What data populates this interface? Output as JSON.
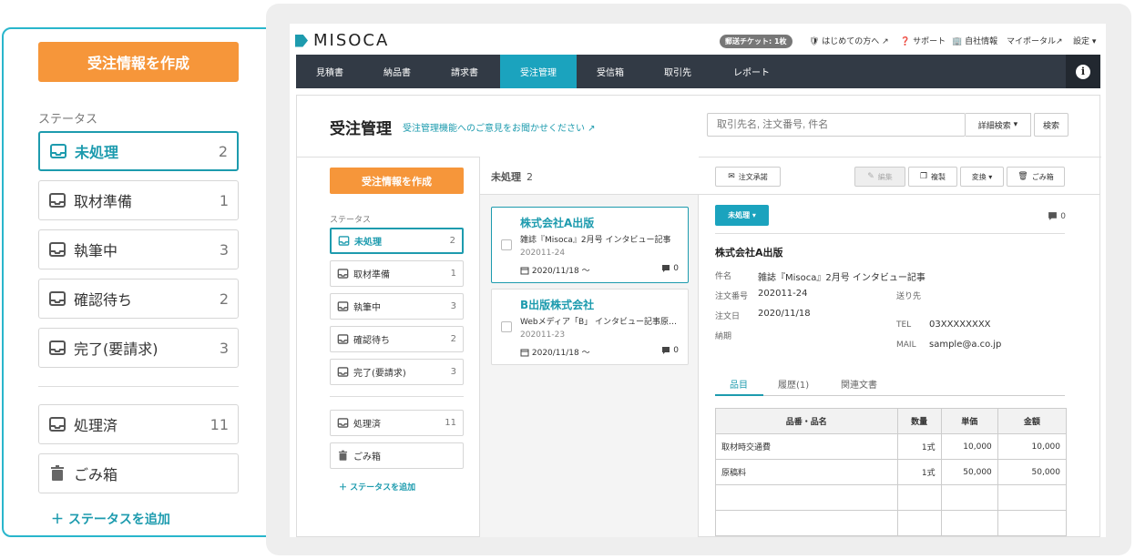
{
  "zoom": {
    "create_button": "受注情報を作成",
    "status_label": "ステータス",
    "items": [
      {
        "label": "未処理",
        "count": "2"
      },
      {
        "label": "取材準備",
        "count": "1"
      },
      {
        "label": "執筆中",
        "count": "3"
      },
      {
        "label": "確認待ち",
        "count": "2"
      },
      {
        "label": "完了(要請求)",
        "count": "3"
      }
    ],
    "processed": {
      "label": "処理済",
      "count": "11"
    },
    "trash": {
      "label": "ごみ箱"
    },
    "add_status": "＋ ステータスを追加"
  },
  "topbar": {
    "logo": "MISOCA",
    "ticket": "郵送チケット: 1枚",
    "links": [
      "はじめての方へ",
      "サポート",
      "自社情報",
      "マイポータル",
      "設定"
    ]
  },
  "nav": {
    "tabs": [
      "見積書",
      "納品書",
      "請求書",
      "受注管理",
      "受信箱",
      "取引先",
      "レポート"
    ],
    "active_index": 3
  },
  "page": {
    "title": "受注管理",
    "feedback_link": "受注管理機能へのご意見をお聞かせください",
    "search_placeholder": "取引先名, 注文番号, 件名",
    "advanced_search": "詳細検索",
    "search_button": "検索"
  },
  "sidebar": {
    "create_button": "受注情報を作成",
    "status_label": "ステータス",
    "items": [
      {
        "label": "未処理",
        "count": "2"
      },
      {
        "label": "取材準備",
        "count": "1"
      },
      {
        "label": "執筆中",
        "count": "3"
      },
      {
        "label": "確認待ち",
        "count": "2"
      },
      {
        "label": "完了(要請求)",
        "count": "3"
      }
    ],
    "processed": {
      "label": "処理済",
      "count": "11"
    },
    "trash": {
      "label": "ごみ箱"
    },
    "add_status": "＋ ステータスを追加"
  },
  "list": {
    "header": "未処理",
    "count": "2",
    "cards": [
      {
        "company": "株式会社A出版",
        "subject": "雑誌『Misoca』2月号 インタビュー記事",
        "number": "202011-24",
        "date": "2020/11/18 〜",
        "comments": "0"
      },
      {
        "company": "B出版株式会社",
        "subject": "Webメディア「B」 インタビュー記事原…",
        "number": "202011-23",
        "date": "2020/11/18 〜",
        "comments": "0"
      }
    ]
  },
  "detail": {
    "toolbar": {
      "approve": "注文承諾",
      "edit": "編集",
      "copy": "複製",
      "convert": "変換",
      "trash": "ごみ箱"
    },
    "status": "未処理",
    "comments": "0",
    "company": "株式会社A出版",
    "subject_label": "件名",
    "subject": "雑誌『Misoca』2月号 インタビュー記事",
    "order_no_label": "注文番号",
    "order_no": "202011-24",
    "order_date_label": "注文日",
    "order_date": "2020/11/18",
    "due_label": "納期",
    "ship_to_label": "送り先",
    "tel_label": "TEL",
    "tel": "03XXXXXXXX",
    "mail_label": "MAIL",
    "mail": "sample@a.co.jp",
    "tabs": [
      "品目",
      "履歴(1)",
      "関連文書"
    ],
    "table": {
      "headers": [
        "品番・品名",
        "数量",
        "単価",
        "金額"
      ],
      "rows": [
        [
          "取材時交通費",
          "1式",
          "10,000",
          "10,000"
        ],
        [
          "原稿料",
          "1式",
          "50,000",
          "50,000"
        ]
      ]
    }
  },
  "colors": {
    "accent": "#1d9bae",
    "create": "#f6963a",
    "nav": "#323a45"
  }
}
